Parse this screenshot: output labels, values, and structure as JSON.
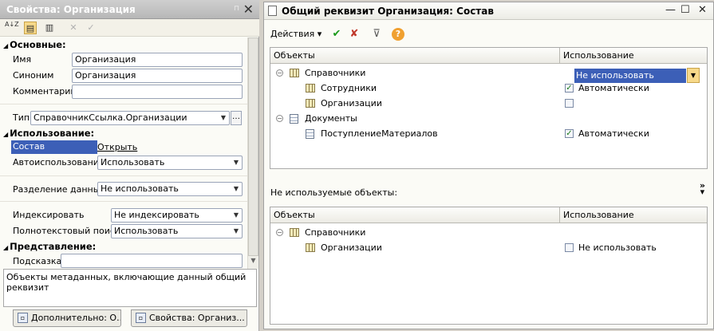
{
  "left_panel": {
    "title": "Свойства: Организация",
    "pin_icon": "pin-icon",
    "close_label": "✕",
    "toolbar": {
      "sort_alpha_label": "A↓Z",
      "close_disabled": "✕",
      "check_disabled": "✓"
    },
    "groups": {
      "main": "Основные:",
      "usage": "Использование:",
      "presentation": "Представление:"
    },
    "fields": {
      "name_label": "Имя",
      "name_value": "Организация",
      "synonym_label": "Синоним",
      "synonym_value": "Организация",
      "comment_label": "Комментарий",
      "comment_value": "",
      "type_label": "Тип",
      "type_value": "СправочникСсылка.Организации",
      "sostav_label": "Состав",
      "sostav_link": "Открыть",
      "autouse_label": "Автоиспользование",
      "autouse_value": "Использовать",
      "data_split_label": "Разделение данных",
      "data_split_value": "Не использовать",
      "index_label": "Индексировать",
      "index_value": "Не индексировать",
      "fulltext_label": "Полнотекстовый поиск",
      "fulltext_value": "Использовать",
      "hint_label": "Подсказка",
      "hint_value": ""
    },
    "description": "Объекты метаданных, включающие данный общий реквизит",
    "tabs": [
      {
        "label": "Дополнительно: О..."
      },
      {
        "label": "Свойства: Организ..."
      }
    ]
  },
  "right_panel": {
    "title": "Общий реквизит Организация: Состав",
    "window_buttons": {
      "minimize": "—",
      "maximize": "☐",
      "close": "✕"
    },
    "toolbar": {
      "actions_label": "Действия ▾"
    },
    "grid1": {
      "col_objects": "Объекты",
      "col_usage": "Использование",
      "rows": [
        {
          "name": "Справочники",
          "usage": ""
        },
        {
          "name": "Сотрудники",
          "usage": "Автоматически"
        },
        {
          "name": "Организации",
          "usage": "Не использовать"
        },
        {
          "name": "Документы",
          "usage": ""
        },
        {
          "name": "ПоступлениеМатериалов",
          "usage": "Автоматически"
        }
      ]
    },
    "unused_label": "Не используемые объекты:",
    "grid2": {
      "col_objects": "Объекты",
      "col_usage": "Использование",
      "rows": [
        {
          "name": "Справочники",
          "usage": ""
        },
        {
          "name": "Организации",
          "usage": "Не использовать"
        }
      ]
    }
  },
  "colors": {
    "selection": "#3c5fb7",
    "accent_orange": "#f7d98a",
    "check_green": "#1a7a1a",
    "delete_red": "#c0392b"
  }
}
